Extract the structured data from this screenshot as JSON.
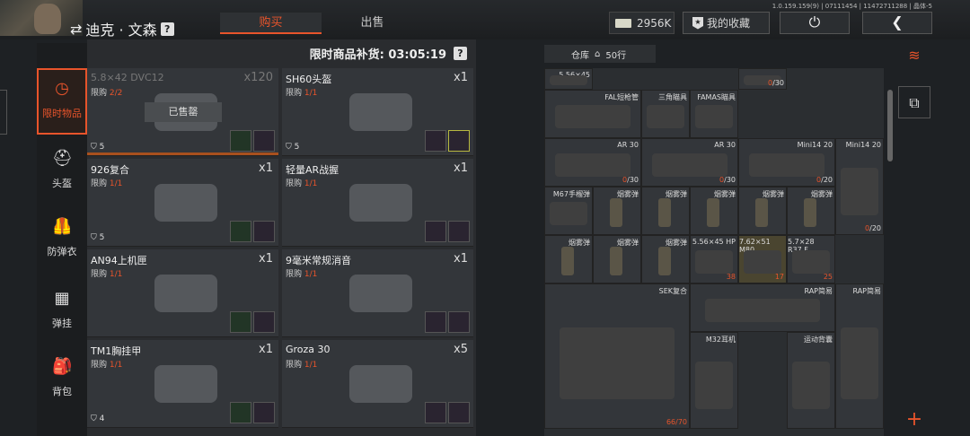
{
  "header": {
    "player_name": "迪克 · 文森",
    "help_glyph": "?",
    "tabs": [
      "购买",
      "出售"
    ],
    "version": "1.0.159.159(9) | 07111454 | 11472711288 | 晶体-5",
    "money": "2956K",
    "favorites": "我的收藏",
    "power_glyph": "⏻",
    "back_glyph": "❮"
  },
  "sidebar": [
    {
      "label": "限时物品",
      "icon": "clock-icon",
      "glyph": "◷",
      "active": true
    },
    {
      "label": "头盔",
      "icon": "helmet-icon",
      "glyph": "⛑"
    },
    {
      "label": "防弹衣",
      "icon": "vest-icon",
      "glyph": "🦺"
    },
    {
      "label": "弹挂",
      "icon": "chest-rig-icon",
      "glyph": "▦"
    },
    {
      "label": "背包",
      "icon": "backpack-icon",
      "glyph": "🎒"
    }
  ],
  "shop": {
    "restock_label": "限时商品补货: 03:05:19",
    "items": [
      {
        "name": "5.8×42 DVC12",
        "qty": "x120",
        "limit_label": "限购 ",
        "limit": "2/2",
        "level": "5",
        "sold": "已售罄"
      },
      {
        "name": "SH60头盔",
        "qty": "x1",
        "limit_label": "限购 ",
        "limit": "1/1",
        "level": "5"
      },
      {
        "name": "926复合",
        "qty": "x1",
        "limit_label": "限购 ",
        "limit": "1/1",
        "level": "5"
      },
      {
        "name": "轻量AR战握",
        "qty": "x1",
        "limit_label": "限购 ",
        "limit": "1/1",
        "level": ""
      },
      {
        "name": "AN94上机匣",
        "qty": "x1",
        "limit_label": "限购 ",
        "limit": "1/1",
        "level": ""
      },
      {
        "name": "9毫米常规消音",
        "qty": "x1",
        "limit_label": "限购 ",
        "limit": "1/1",
        "level": ""
      },
      {
        "name": "TM1胸挂甲",
        "qty": "x1",
        "limit_label": "限购 ",
        "limit": "1/1",
        "level": "4"
      },
      {
        "name": "Groza 30",
        "qty": "x5",
        "limit_label": "限购 ",
        "limit": "1/1",
        "level": ""
      }
    ]
  },
  "storage": {
    "title": "仓库",
    "rows": "50行",
    "cells": [
      {
        "t": "5.56×45",
        "n": "",
        "c": "",
        "r": 0,
        "col": 0,
        "w": 1
      },
      {
        "t": "",
        "n": "0",
        "c": "/30",
        "r": 0,
        "col": 4,
        "w": 1
      },
      {
        "t": "FAL短枪管",
        "n": "",
        "c": "",
        "r": 1,
        "col": 0,
        "w": 2
      },
      {
        "t": "三角瞄具",
        "n": "",
        "c": "",
        "r": 1,
        "col": 2,
        "w": 1
      },
      {
        "t": "FAMAS瞄具",
        "n": "",
        "c": "",
        "r": 1,
        "col": 3,
        "w": 1
      },
      {
        "t": "AR 30",
        "n": "0",
        "c": "/30",
        "r": 2,
        "col": 0,
        "w": 2
      },
      {
        "t": "AR 30",
        "n": "0",
        "c": "/30",
        "r": 2,
        "col": 2,
        "w": 2
      },
      {
        "t": "Mini14 20",
        "n": "0",
        "c": "/20",
        "r": 2,
        "col": 4,
        "w": 2
      },
      {
        "t": "Mini14 20",
        "n": "0",
        "c": "/20",
        "r": 2,
        "col": 6,
        "w": 1,
        "h": 2
      },
      {
        "t": "M67手榴弹",
        "n": "",
        "c": "",
        "r": 3,
        "col": 0,
        "w": 1
      },
      {
        "t": "烟雾弹",
        "n": "",
        "c": "",
        "r": 3,
        "col": 1,
        "w": 1
      },
      {
        "t": "烟雾弹",
        "n": "",
        "c": "",
        "r": 3,
        "col": 2,
        "w": 1
      },
      {
        "t": "烟雾弹",
        "n": "",
        "c": "",
        "r": 3,
        "col": 3,
        "w": 1
      },
      {
        "t": "烟雾弹",
        "n": "",
        "c": "",
        "r": 3,
        "col": 4,
        "w": 1
      },
      {
        "t": "烟雾弹",
        "n": "",
        "c": "",
        "r": 3,
        "col": 5,
        "w": 1
      },
      {
        "t": "烟雾弹",
        "n": "",
        "c": "",
        "r": 4,
        "col": 0,
        "w": 1
      },
      {
        "t": "烟雾弹",
        "n": "",
        "c": "",
        "r": 4,
        "col": 1,
        "w": 1
      },
      {
        "t": "烟雾弹",
        "n": "",
        "c": "",
        "r": 4,
        "col": 2,
        "w": 1
      },
      {
        "t": "5.56×45 HP",
        "n": "38",
        "c": "",
        "r": 4,
        "col": 3,
        "w": 1
      },
      {
        "t": "7.62×51 M80",
        "n": "17",
        "c": "",
        "r": 4,
        "col": 4,
        "w": 1,
        "y": true
      },
      {
        "t": "5.7×28 R37.F",
        "n": "25",
        "c": "",
        "r": 4,
        "col": 5,
        "w": 1
      },
      {
        "t": "SEK复合",
        "n": "66/70",
        "c": "",
        "r": 5,
        "col": 0,
        "w": 3,
        "h": 3
      },
      {
        "t": "RAP简易",
        "n": "",
        "c": "",
        "r": 5,
        "col": 3,
        "w": 3
      },
      {
        "t": "RAP简易",
        "n": "",
        "c": "",
        "r": 5,
        "col": 6,
        "w": 1,
        "h": 3
      },
      {
        "t": "M32耳机",
        "n": "",
        "c": "",
        "r": 6,
        "col": 3,
        "w": 1,
        "h": 2
      },
      {
        "t": "运动背囊",
        "n": "",
        "c": "",
        "r": 6,
        "col": 5,
        "w": 1,
        "h": 2
      }
    ]
  },
  "right_rail": {
    "plus": "+"
  }
}
